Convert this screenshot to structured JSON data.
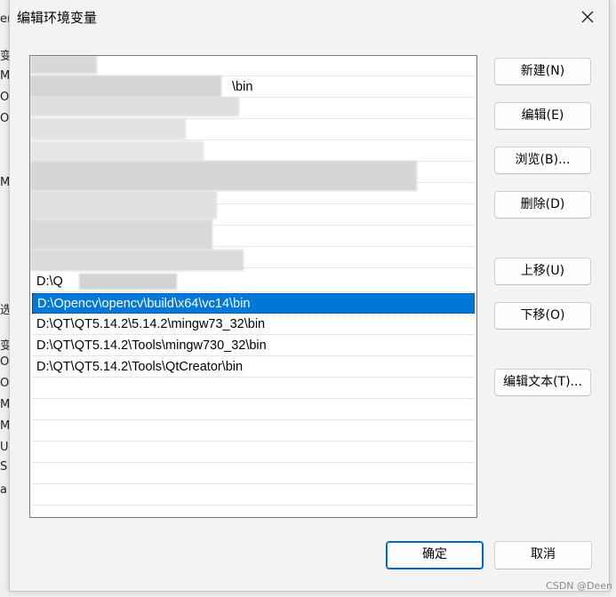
{
  "dialog": {
    "title": "编辑环境变量",
    "close_label": "✕"
  },
  "list": {
    "partial_items": [
      "\\bin",
      "D:\\Q"
    ],
    "items": [
      "D:\\Opencv\\opencv\\build\\x64\\vc14\\bin",
      "D:\\QT\\QT5.14.2\\5.14.2\\mingw73_32\\bin",
      "D:\\QT\\QT5.14.2\\Tools\\mingw730_32\\bin",
      "D:\\QT\\QT5.14.2\\Tools\\QtCreator\\bin"
    ],
    "selected_index": 0
  },
  "buttons": {
    "new": "新建(N)",
    "edit": "编辑(E)",
    "browse": "浏览(B)...",
    "delete": "删除(D)",
    "move_up": "上移(U)",
    "move_down": "下移(O)",
    "edit_text": "编辑文本(T)...",
    "ok": "确定",
    "cancel": "取消"
  },
  "background_fragments": [
    "er",
    "变",
    "MC",
    "Or",
    "Or",
    "M",
    "选",
    "变",
    "O",
    "Or",
    "M",
    "M",
    "U",
    "S",
    "a"
  ],
  "watermark": "CSDN @Deen",
  "colors": {
    "selection": "#0078d7",
    "ok_border": "#0067c0"
  }
}
